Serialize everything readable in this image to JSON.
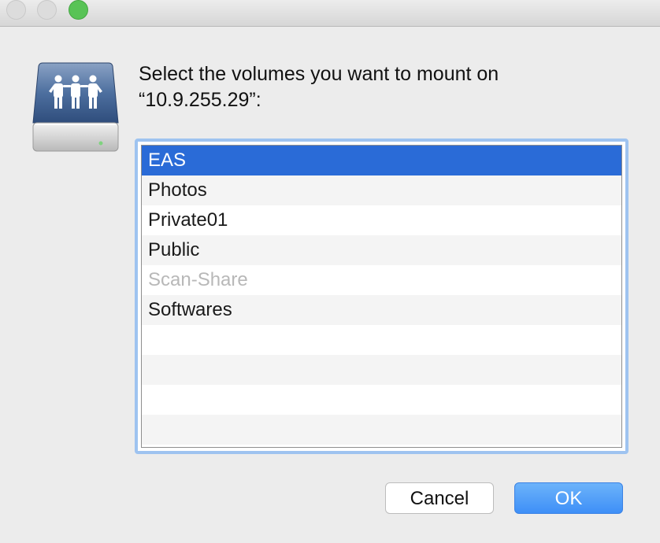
{
  "window": {
    "controls": [
      {
        "name": "close-button",
        "color": "#dcdcdc"
      },
      {
        "name": "minimize-button",
        "color": "#dcdcdc"
      },
      {
        "name": "zoom-button",
        "color": "#58c356"
      }
    ]
  },
  "icon": {
    "name": "network-server-drive-icon",
    "accent": "#3a5f96"
  },
  "prompt": {
    "line1": "Select the volumes you want to mount on",
    "line2": "“10.9.255.29”:"
  },
  "volumes": {
    "items": [
      {
        "label": "EAS",
        "state": "selected"
      },
      {
        "label": "Photos",
        "state": "normal"
      },
      {
        "label": "Private01",
        "state": "normal"
      },
      {
        "label": "Public",
        "state": "normal"
      },
      {
        "label": "Scan-Share",
        "state": "disabled"
      },
      {
        "label": "Softwares",
        "state": "normal"
      },
      {
        "label": "",
        "state": "empty"
      },
      {
        "label": "",
        "state": "empty"
      },
      {
        "label": "",
        "state": "empty"
      },
      {
        "label": "",
        "state": "empty"
      }
    ],
    "selection_color": "#2a6bd7"
  },
  "buttons": {
    "cancel_label": "Cancel",
    "ok_label": "OK",
    "ok_color": "#3e8ff7"
  }
}
